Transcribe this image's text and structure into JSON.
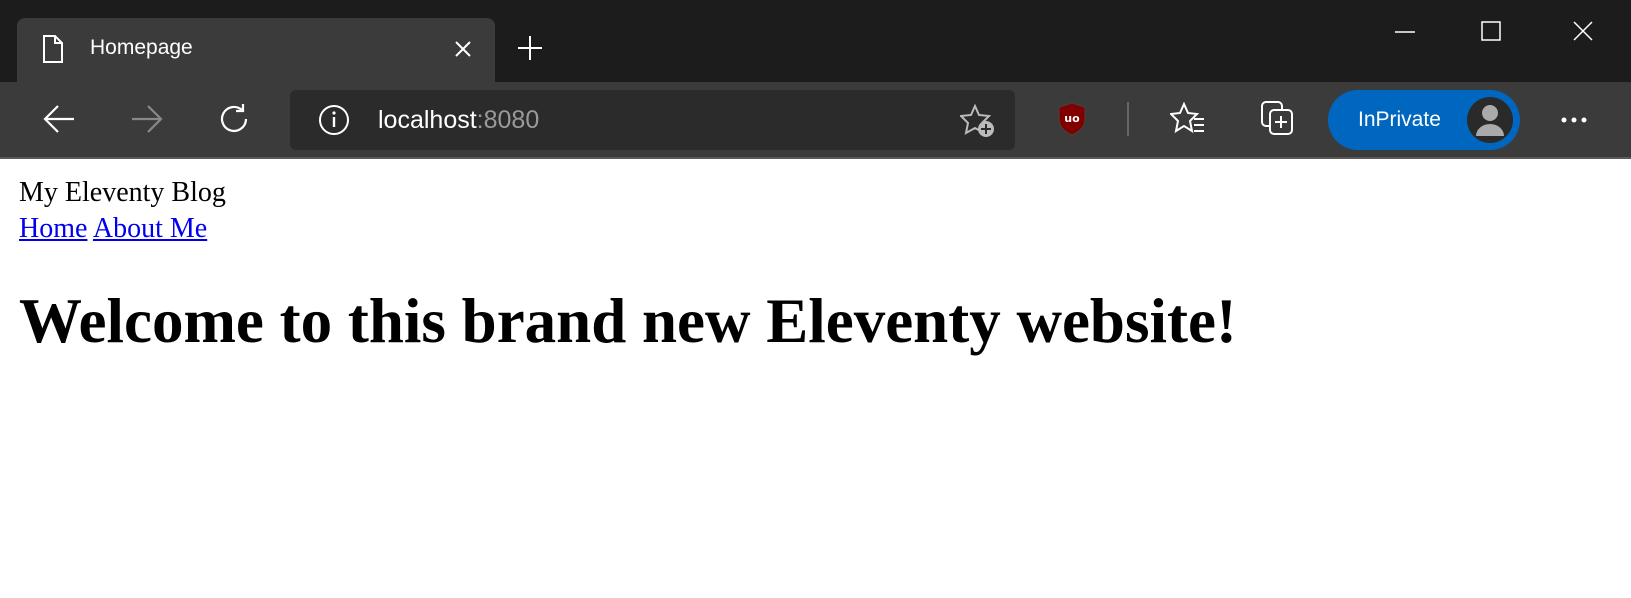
{
  "browser": {
    "tab_title": "Homepage",
    "address_host": "localhost",
    "address_port": ":8080",
    "inprivate_label": "InPrivate"
  },
  "page": {
    "site_title": "My Eleventy Blog",
    "nav": [
      {
        "label": "Home"
      },
      {
        "label": "About Me"
      }
    ],
    "heading": "Welcome to this brand new Eleventy website!"
  },
  "colors": {
    "inprivate": "#0067c0",
    "link": "#0000ee",
    "ublock": "#800000"
  }
}
